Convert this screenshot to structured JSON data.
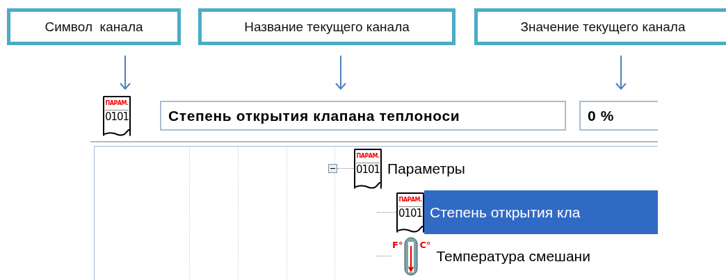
{
  "callouts": [
    {
      "label": "Символ  канала"
    },
    {
      "label": "Название текущего канала"
    },
    {
      "label": "Значение текущего канала"
    }
  ],
  "header": {
    "symbol": {
      "kind": "param",
      "caption": "ПАРАМ.",
      "code": "0101"
    },
    "name": "Степень открытия клапана теплоноси",
    "value": "0 %"
  },
  "tree": [
    {
      "label": "Параметры",
      "kind": "param",
      "caption": "ПАРАМ.",
      "code": "0101",
      "expanded": true,
      "selected": false,
      "children": [
        {
          "label": "Степень открытия кла",
          "kind": "param",
          "caption": "ПАРАМ.",
          "code": "0101",
          "selected": true
        },
        {
          "label": "Температура смешани",
          "kind": "thermo",
          "left_unit": "F°",
          "right_unit": "C°",
          "selected": false
        }
      ]
    }
  ]
}
